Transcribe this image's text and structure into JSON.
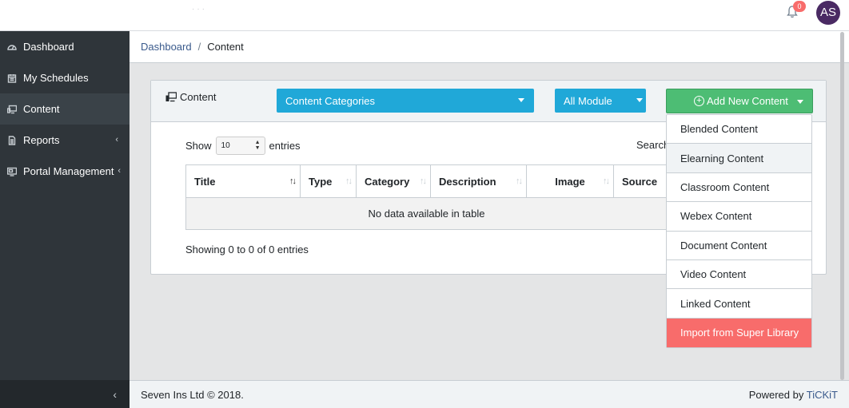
{
  "header": {
    "notification_count": "0",
    "avatar_initials": "AS"
  },
  "sidebar": {
    "items": [
      {
        "label": "Dashboard",
        "icon": "dashboard-icon",
        "active": false,
        "has_submenu": false
      },
      {
        "label": "My Schedules",
        "icon": "calendar-icon",
        "active": false,
        "has_submenu": false
      },
      {
        "label": "Content",
        "icon": "monitor-icon",
        "active": true,
        "has_submenu": false
      },
      {
        "label": "Reports",
        "icon": "document-icon",
        "active": false,
        "has_submenu": true
      },
      {
        "label": "Portal Management",
        "icon": "screen-icon",
        "active": false,
        "has_submenu": true
      }
    ],
    "toggle_glyph": "‹"
  },
  "breadcrumb": {
    "home": "Dashboard",
    "separator": "/",
    "current": "Content"
  },
  "card": {
    "title": "Content",
    "categories_select": "Content Categories",
    "module_select": "All Module",
    "add_button": "Add New Content"
  },
  "datatable": {
    "show_label": "Show",
    "page_length": "10",
    "entries_label": "entries",
    "search_label": "Search",
    "columns": [
      "Title",
      "Type",
      "Category",
      "Description",
      "Image",
      "Source"
    ],
    "empty_message": "No data available in table",
    "info": "Showing 0 to 0 of 0 entries"
  },
  "dropdown": {
    "items": [
      "Blended Content",
      "Elearning Content",
      "Classroom Content",
      "Webex Content",
      "Document Content",
      "Video Content",
      "Linked Content"
    ],
    "highlighted_index": 1,
    "danger_item": "Import from Super Library"
  },
  "footer": {
    "left_text": "Seven Ins Ltd © 2018.",
    "right_prefix": "Powered by",
    "right_link": "TiCKiT"
  },
  "colors": {
    "sidebar_bg": "#2f353a",
    "primary_blue": "#20a8d8",
    "success_green": "#4dbd74",
    "danger_red": "#f86c6b",
    "avatar_purple": "#4a2a63"
  }
}
